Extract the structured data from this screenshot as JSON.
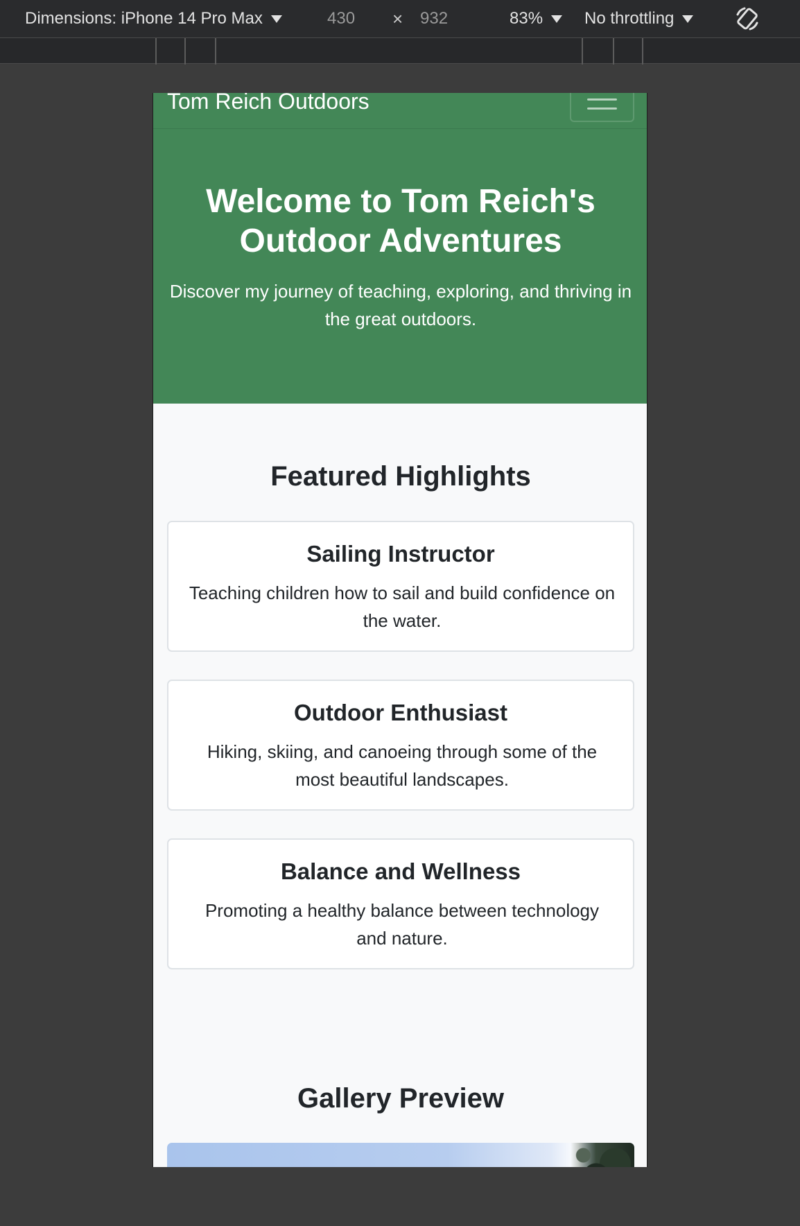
{
  "devtools": {
    "dimensions_label": "Dimensions: iPhone 14 Pro Max",
    "width": "430",
    "times": "×",
    "height": "932",
    "zoom": "83%",
    "throttling": "No throttling",
    "icons": {
      "dropdown": "caret-down-icon",
      "rotate": "rotate-device-icon"
    }
  },
  "site": {
    "brand": "Tom Reich Outdoors",
    "theme_color": "#438757",
    "hero": {
      "title": "Welcome to Tom Reich's Outdoor Adventures",
      "subtitle": "Discover my journey of teaching, exploring, and thriving in the great outdoors."
    },
    "highlights": {
      "title": "Featured Highlights",
      "cards": [
        {
          "title": "Sailing Instructor",
          "text": "Teaching children how to sail and build confidence on the water."
        },
        {
          "title": "Outdoor Enthusiast",
          "text": "Hiking, skiing, and canoeing through some of the most beautiful landscapes."
        },
        {
          "title": "Balance and Wellness",
          "text": "Promoting a healthy balance between technology and nature."
        }
      ]
    },
    "gallery": {
      "title": "Gallery Preview"
    }
  }
}
